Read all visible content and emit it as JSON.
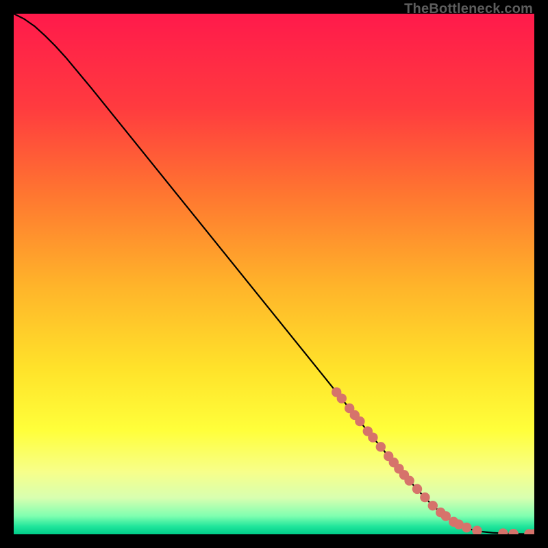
{
  "watermark": "TheBottleneck.com",
  "chart_data": {
    "type": "line",
    "title": "",
    "xlabel": "",
    "ylabel": "",
    "xlim": [
      0,
      100
    ],
    "ylim": [
      0,
      100
    ],
    "grid": false,
    "curve": {
      "name": "bottleneck-curve",
      "x": [
        0,
        2,
        4,
        6,
        8,
        10,
        15,
        20,
        25,
        30,
        35,
        40,
        45,
        50,
        55,
        60,
        62,
        64,
        66,
        68,
        70,
        72,
        74,
        76,
        78,
        80,
        82,
        84,
        86,
        88,
        90,
        92,
        94,
        95,
        96,
        97,
        98,
        99,
        100
      ],
      "y": [
        100,
        99,
        97.6,
        95.8,
        93.8,
        91.6,
        85.6,
        79.4,
        73.2,
        67.0,
        60.8,
        54.6,
        48.4,
        42.2,
        36.0,
        29.8,
        27.3,
        24.8,
        22.3,
        19.8,
        17.4,
        15.0,
        12.6,
        10.3,
        8.1,
        6.0,
        4.2,
        2.7,
        1.6,
        0.9,
        0.5,
        0.3,
        0.18,
        0.14,
        0.11,
        0.09,
        0.07,
        0.06,
        0.05
      ]
    },
    "markers": {
      "name": "highlighted-range",
      "x": [
        62,
        63,
        64.5,
        65.5,
        66.5,
        68,
        69,
        70.5,
        72,
        73,
        74,
        75,
        76,
        77.5,
        79,
        80.5,
        82,
        83,
        84.5,
        85.5,
        87,
        89,
        94,
        96,
        99,
        100
      ],
      "y": [
        27.3,
        26.1,
        24.2,
        22.9,
        21.7,
        19.8,
        18.6,
        16.8,
        15.0,
        13.8,
        12.6,
        11.4,
        10.3,
        8.7,
        7.1,
        5.5,
        4.2,
        3.5,
        2.4,
        1.9,
        1.3,
        0.7,
        0.18,
        0.11,
        0.06,
        0.05
      ]
    },
    "background_gradient": {
      "stops": [
        {
          "offset": 0.0,
          "color": "#ff1a4b"
        },
        {
          "offset": 0.18,
          "color": "#ff3b3f"
        },
        {
          "offset": 0.35,
          "color": "#ff7730"
        },
        {
          "offset": 0.52,
          "color": "#ffb32a"
        },
        {
          "offset": 0.68,
          "color": "#ffe22a"
        },
        {
          "offset": 0.8,
          "color": "#ffff3a"
        },
        {
          "offset": 0.88,
          "color": "#f7ff8a"
        },
        {
          "offset": 0.93,
          "color": "#d8ffb0"
        },
        {
          "offset": 0.965,
          "color": "#7fffb0"
        },
        {
          "offset": 0.985,
          "color": "#20e59b"
        },
        {
          "offset": 1.0,
          "color": "#00cc88"
        }
      ]
    },
    "marker_color": "#d6736b",
    "curve_color": "#000000"
  }
}
